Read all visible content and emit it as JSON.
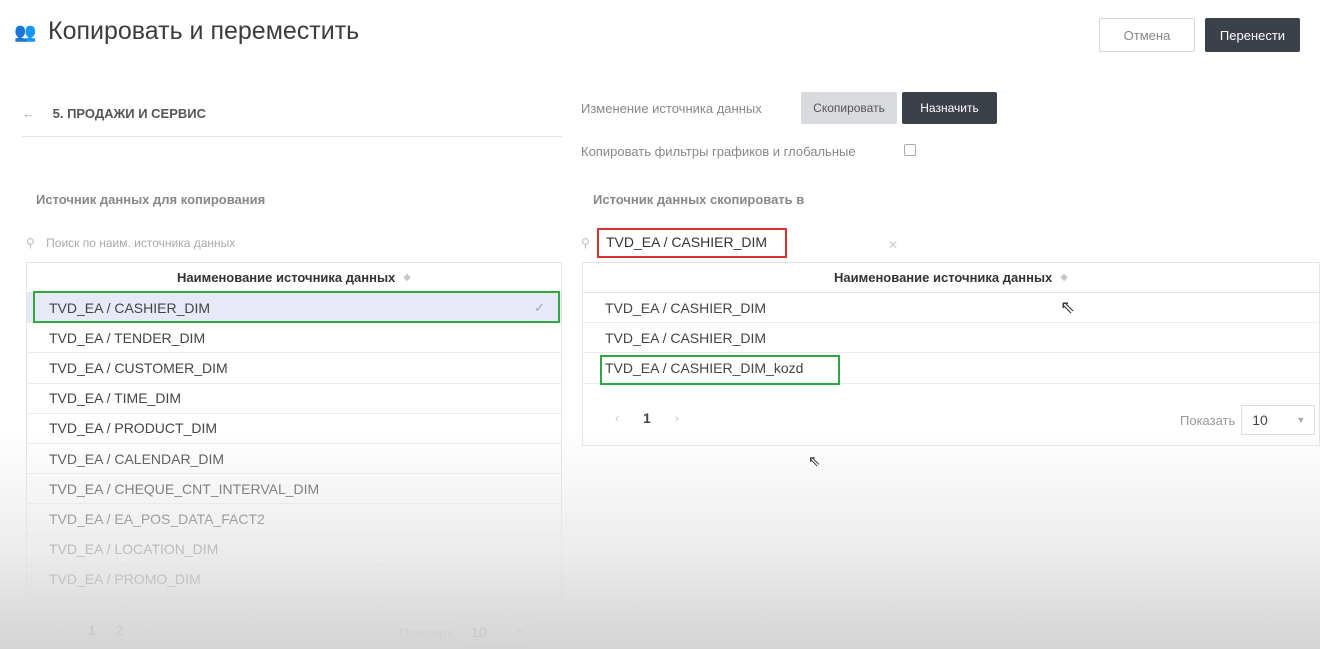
{
  "header": {
    "title": "Копировать и переместить",
    "cancel_label": "Отмена",
    "move_label": "Перенести"
  },
  "left": {
    "breadcrumb_arrow": "←",
    "breadcrumb": "5. ПРОДАЖИ И СЕРВИС",
    "section_label": "Источник данных для копирования",
    "search_placeholder": "Поиск по наим. источника данных",
    "column_header": "Наименование источника данных",
    "rows": [
      "TVD_EA / CASHIER_DIM",
      "TVD_EA / TENDER_DIM",
      "TVD_EA / CUSTOMER_DIM",
      "TVD_EA / TIME_DIM",
      "TVD_EA / PRODUCT_DIM",
      "TVD_EA / CALENDAR_DIM",
      "TVD_EA / CHEQUE_CNT_INTERVAL_DIM",
      "TVD_EA / EA_POS_DATA_FACT2",
      "TVD_EA / LOCATION_DIM",
      "TVD_EA / PROMO_DIM"
    ],
    "selected_index": 0,
    "pages": [
      "1",
      "2"
    ],
    "show_label": "Показать",
    "show_value": "10"
  },
  "right": {
    "change_source_label": "Изменение источника данных",
    "copy_label": "Скопировать",
    "assign_label": "Назначить",
    "copy_filters_label": "Копировать фильтры графиков и глобальные",
    "section_label": "Источник данных скопировать в",
    "search_value": "TVD_EA / CASHIER_DIM",
    "column_header": "Наименование источника данных",
    "rows": [
      "TVD_EA / CASHIER_DIM",
      "TVD_EA / CASHIER_DIM",
      "TVD_EA / CASHIER_DIM_kozd"
    ],
    "pages": [
      "1"
    ],
    "show_label": "Показать",
    "show_value": "10"
  },
  "icons": {
    "title_icon": "people-icon",
    "search_icon": "search-icon",
    "check_icon": "checkmark-icon",
    "clear_icon": "close-icon",
    "sort_icon": "sort-icon"
  },
  "colors": {
    "primary_dark": "#3b4148",
    "highlight_green": "#2daa3f",
    "highlight_red": "#d93030",
    "selected_row": "#e8e9f6"
  }
}
